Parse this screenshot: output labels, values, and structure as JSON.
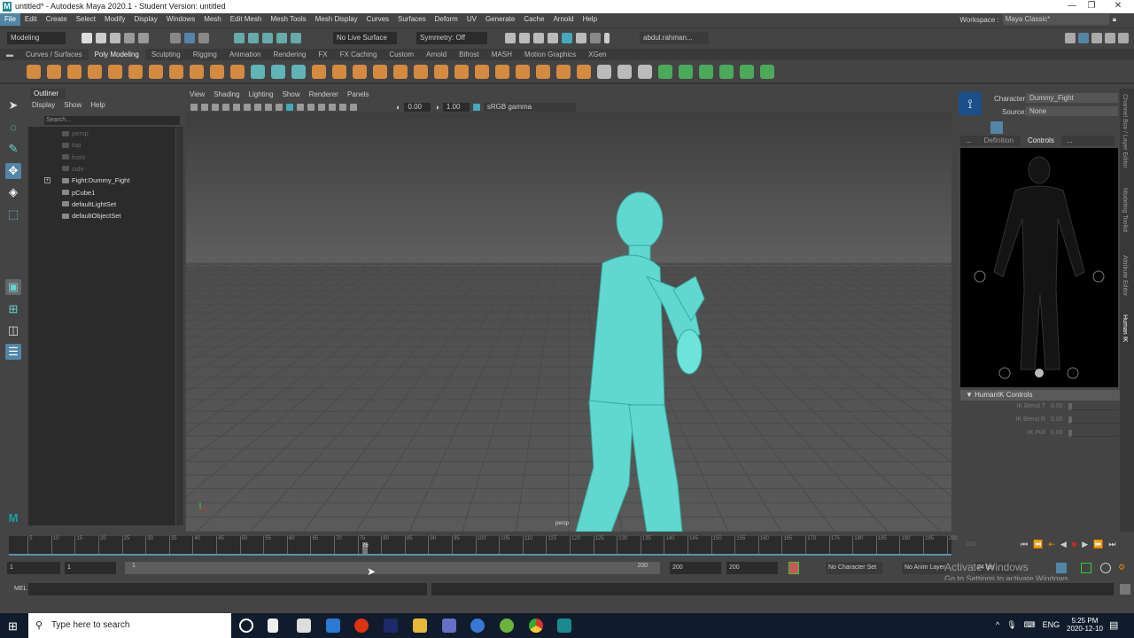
{
  "window": {
    "title": "untitled* - Autodesk Maya 2020.1 - Student Version: untitled",
    "logo": "M",
    "minimize": "—",
    "restore": "❐",
    "close": "✕"
  },
  "menu": [
    "File",
    "Edit",
    "Create",
    "Select",
    "Modify",
    "Display",
    "Windows",
    "Mesh",
    "Edit Mesh",
    "Mesh Tools",
    "Mesh Display",
    "Curves",
    "Surfaces",
    "Deform",
    "UV",
    "Generate",
    "Cache",
    "Arnold",
    "Help"
  ],
  "workspace": {
    "label": "Workspace :",
    "value": "Maya Classic*"
  },
  "status": {
    "mode": "Modeling",
    "live_surface": "No Live Surface",
    "symmetry": "Symmetry: Off",
    "user": "abdul.rahman..."
  },
  "shelf_tabs": [
    "Curves / Surfaces",
    "Poly Modeling",
    "Sculpting",
    "Rigging",
    "Animation",
    "Rendering",
    "FX",
    "FX Caching",
    "Custom",
    "Arnold",
    "Bifrost",
    "MASH",
    "Motion Graphics",
    "XGen"
  ],
  "shelf_icons": [
    "sphere",
    "cube",
    "cylinder",
    "cone",
    "torus",
    "plane",
    "disc",
    "platonic",
    "sweep",
    "type",
    "svg",
    "center-pivot",
    "freeze",
    "reset",
    "combine",
    "separate",
    "smooth",
    "extract",
    "boolean",
    "mirror",
    "bridge",
    "extrude",
    "bevel",
    "fill-hole",
    "multi-cut",
    "target-weld",
    "connect",
    "knife",
    "edge-loop",
    "insert-loop",
    "offset-loop",
    "uv-editor",
    "planar",
    "auto-uv",
    "cut-uv",
    "sew-uv",
    "unfold"
  ],
  "outliner": {
    "tab": "Outliner",
    "menu": [
      "Display",
      "Show",
      "Help"
    ],
    "search_placeholder": "Search...",
    "items": [
      {
        "label": "persp",
        "dim": true
      },
      {
        "label": "top",
        "dim": true
      },
      {
        "label": "front",
        "dim": true
      },
      {
        "label": "side",
        "dim": true
      },
      {
        "label": "Fight:Dummy_Fight",
        "dim": false,
        "expand": "+"
      },
      {
        "label": "pCube1",
        "dim": false
      },
      {
        "label": "defaultLightSet",
        "dim": false
      },
      {
        "label": "defaultObjectSet",
        "dim": false
      }
    ]
  },
  "viewport": {
    "menu": [
      "View",
      "Shading",
      "Lighting",
      "Show",
      "Renderer",
      "Panels"
    ],
    "exposure": "0.00",
    "gamma": "1.00",
    "color_space": "sRGB gamma",
    "camera_label": "persp"
  },
  "humanik": {
    "character_label": "Character:",
    "character": "Dummy_Fight",
    "source_label": "Source:",
    "source": "None",
    "tabs": [
      "...",
      "Definition",
      "Controls",
      "..."
    ],
    "section": "HumanIK Controls",
    "rows": [
      {
        "label": "IK Blend T",
        "value": "0.00"
      },
      {
        "label": "IK Blend R",
        "value": "0.00"
      },
      {
        "label": "IK Pull",
        "value": "0.00"
      }
    ]
  },
  "side_tabs": [
    "Channel Box / Layer Editor",
    "Modeling Toolkit",
    "Attribute Editor",
    "Human IK"
  ],
  "timeline": {
    "ticks": [
      5,
      10,
      15,
      20,
      25,
      30,
      35,
      40,
      45,
      50,
      55,
      60,
      65,
      70,
      75,
      80,
      85,
      90,
      95,
      100,
      105,
      110,
      115,
      120,
      125,
      130,
      135,
      140,
      145,
      150,
      155,
      160,
      165,
      170,
      175,
      180,
      185,
      190,
      195,
      200
    ],
    "current_frame": "75",
    "end_display": "200",
    "range_start": "1",
    "playback_start": "1",
    "slider_start": "1",
    "slider_end": "200",
    "playback_end": "200",
    "anim_end": "200",
    "character_set": "No Character Set",
    "anim_layer": "No Anim Layer",
    "fps": "24 fps"
  },
  "cmd": {
    "label": "MEL"
  },
  "watermark": {
    "line1": "Activate Windows",
    "line2": "Go to Settings to activate Windows."
  },
  "taskbar": {
    "search_placeholder": "Type here to search",
    "lang": "ENG",
    "time": "5:25 PM",
    "date": "2020-12-10"
  },
  "colors": {
    "accent": "#5285a6",
    "mesh": "#5fd9d0",
    "shelf": "#d48a3f"
  }
}
